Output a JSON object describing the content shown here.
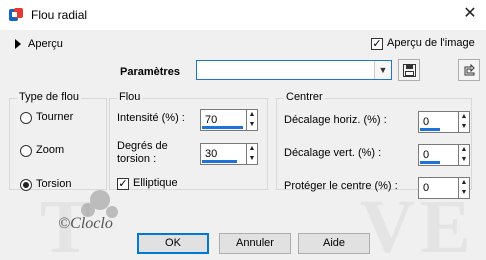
{
  "window": {
    "title": "Flou radial",
    "close_glyph": "✕"
  },
  "preview": {
    "toggle_label": "Aperçu",
    "image_preview_label": "Aperçu de l'image",
    "image_preview_checked": true
  },
  "presets": {
    "label": "Paramètres",
    "value": ""
  },
  "blur_type": {
    "legend": "Type de flou",
    "options": [
      {
        "label": "Tourner",
        "selected": false
      },
      {
        "label": "Zoom",
        "selected": false
      },
      {
        "label": "Torsion",
        "selected": true
      }
    ]
  },
  "blur": {
    "legend": "Flou",
    "intensity_label": "Intensité (%) :",
    "intensity_value": "70",
    "twist_label_line1": "Degrés de",
    "twist_label_line2": "torsion :",
    "twist_value": "30",
    "elliptic_label": "Elliptique",
    "elliptic_checked": true
  },
  "center": {
    "legend": "Centrer",
    "horiz_label": "Décalage horiz. (%) :",
    "horiz_value": "0",
    "vert_label": "Décalage vert. (%) :",
    "vert_value": "0",
    "protect_label": "Protéger le centre (%) :",
    "protect_value": "0"
  },
  "buttons": {
    "ok": "OK",
    "cancel": "Annuler",
    "help": "Aide"
  },
  "watermark": {
    "signature": "©Cloclo"
  },
  "colors": {
    "accent": "#1e74d6",
    "dialog_bg": "#f0f0f0"
  }
}
